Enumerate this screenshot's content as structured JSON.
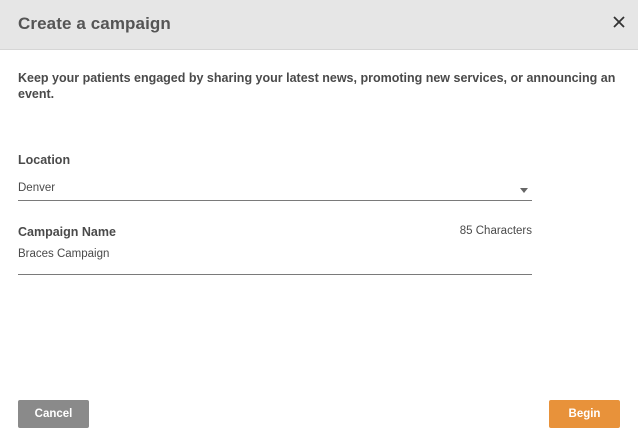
{
  "dialog": {
    "title": "Create a campaign",
    "close_icon": "close-icon",
    "intro": "Keep your patients engaged by sharing your latest news, promoting new services, or announcing an event."
  },
  "form": {
    "location": {
      "label": "Location",
      "value": "Denver",
      "icon": "caret-down-icon"
    },
    "campaign_name": {
      "label": "Campaign Name",
      "counter": "85 Characters",
      "value": "Braces Campaign"
    }
  },
  "footer": {
    "cancel_label": "Cancel",
    "begin_label": "Begin"
  },
  "colors": {
    "header_bg": "#e6e6e6",
    "cancel_bg": "#8a8a8a",
    "begin_bg": "#e8923a"
  }
}
